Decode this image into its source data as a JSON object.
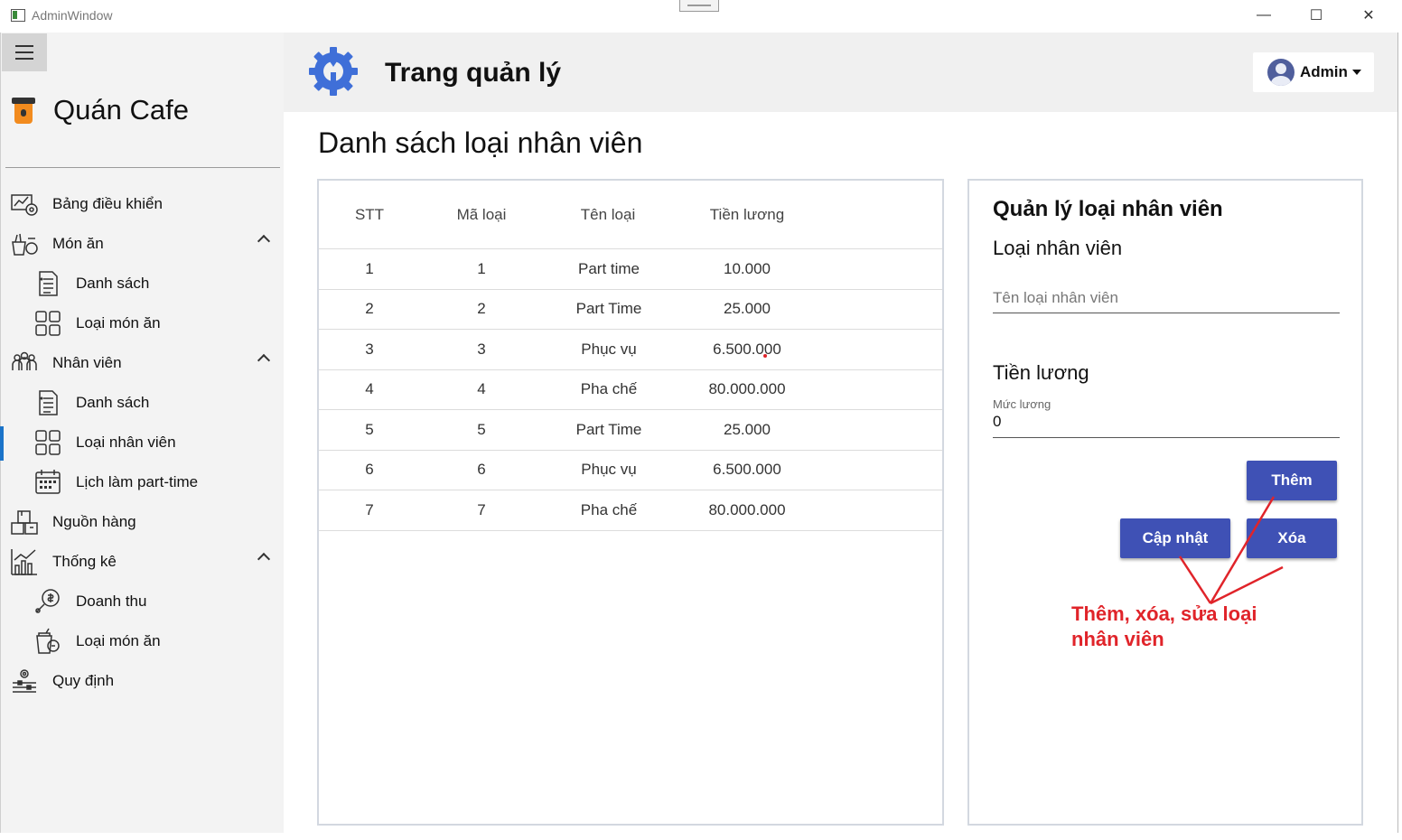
{
  "window": {
    "title": "AdminWindow",
    "controls": {
      "minimize": "—",
      "maximize": "☐",
      "close": "✕"
    }
  },
  "sidebar": {
    "brand": "Quán Cafe",
    "items": [
      {
        "label": "Bảng điều khiển",
        "icon": "dashboard-icon",
        "level": "top"
      },
      {
        "label": "Món ăn",
        "icon": "food-icon",
        "level": "top",
        "expanded": true
      },
      {
        "label": "Danh sách",
        "icon": "list-icon",
        "level": "sub"
      },
      {
        "label": "Loại món ăn",
        "icon": "category-grid-icon",
        "level": "sub"
      },
      {
        "label": "Nhân viên",
        "icon": "staff-icon",
        "level": "top",
        "expanded": true
      },
      {
        "label": "Danh sách",
        "icon": "list-icon",
        "level": "sub"
      },
      {
        "label": "Loại nhân viên",
        "icon": "category-grid-icon",
        "level": "sub",
        "active": true
      },
      {
        "label": "Lịch làm part-time",
        "icon": "calendar-icon",
        "level": "sub"
      },
      {
        "label": "Nguồn hàng",
        "icon": "boxes-icon",
        "level": "top"
      },
      {
        "label": "Thống kê",
        "icon": "stats-icon",
        "level": "top",
        "expanded": true
      },
      {
        "label": "Doanh thu",
        "icon": "revenue-icon",
        "level": "sub"
      },
      {
        "label": "Loại món ăn",
        "icon": "drink-stats-icon",
        "level": "sub"
      },
      {
        "label": "Quy định",
        "icon": "settings-sliders-icon",
        "level": "top"
      }
    ]
  },
  "header": {
    "title": "Trang quản lý",
    "user": "Admin"
  },
  "main": {
    "section_title": "Danh sách loại nhân viên",
    "table": {
      "columns": [
        "STT",
        "Mã loại",
        "Tên loại",
        "Tiền lương"
      ],
      "rows": [
        [
          "1",
          "1",
          "Part time",
          "10.000"
        ],
        [
          "2",
          "2",
          "Part Time",
          "25.000"
        ],
        [
          "3",
          "3",
          "Phục vụ",
          "6.500.000"
        ],
        [
          "4",
          "4",
          "Pha chế",
          "80.000.000"
        ],
        [
          "5",
          "5",
          "Part Time",
          "25.000"
        ],
        [
          "6",
          "6",
          "Phục vụ",
          "6.500.000"
        ],
        [
          "7",
          "7",
          "Pha chế",
          "80.000.000"
        ]
      ]
    }
  },
  "form": {
    "title": "Quản lý loại nhân viên",
    "type_label": "Loại nhân viên",
    "type_placeholder": "Tên loại nhân viên",
    "salary_label": "Tiền lương",
    "salary_hint": "Mức lương",
    "salary_value": "0",
    "add_button": "Thêm",
    "update_button": "Cập nhật",
    "delete_button": "Xóa"
  },
  "annotation": {
    "text": "Thêm, xóa, sửa loại nhân viên",
    "color": "#e0242a"
  },
  "colors": {
    "accent": "#3f51b5",
    "active_indicator": "#1a73c9",
    "sidebar_bg": "#f3f3f3",
    "header_bg": "#f0f0f0"
  }
}
